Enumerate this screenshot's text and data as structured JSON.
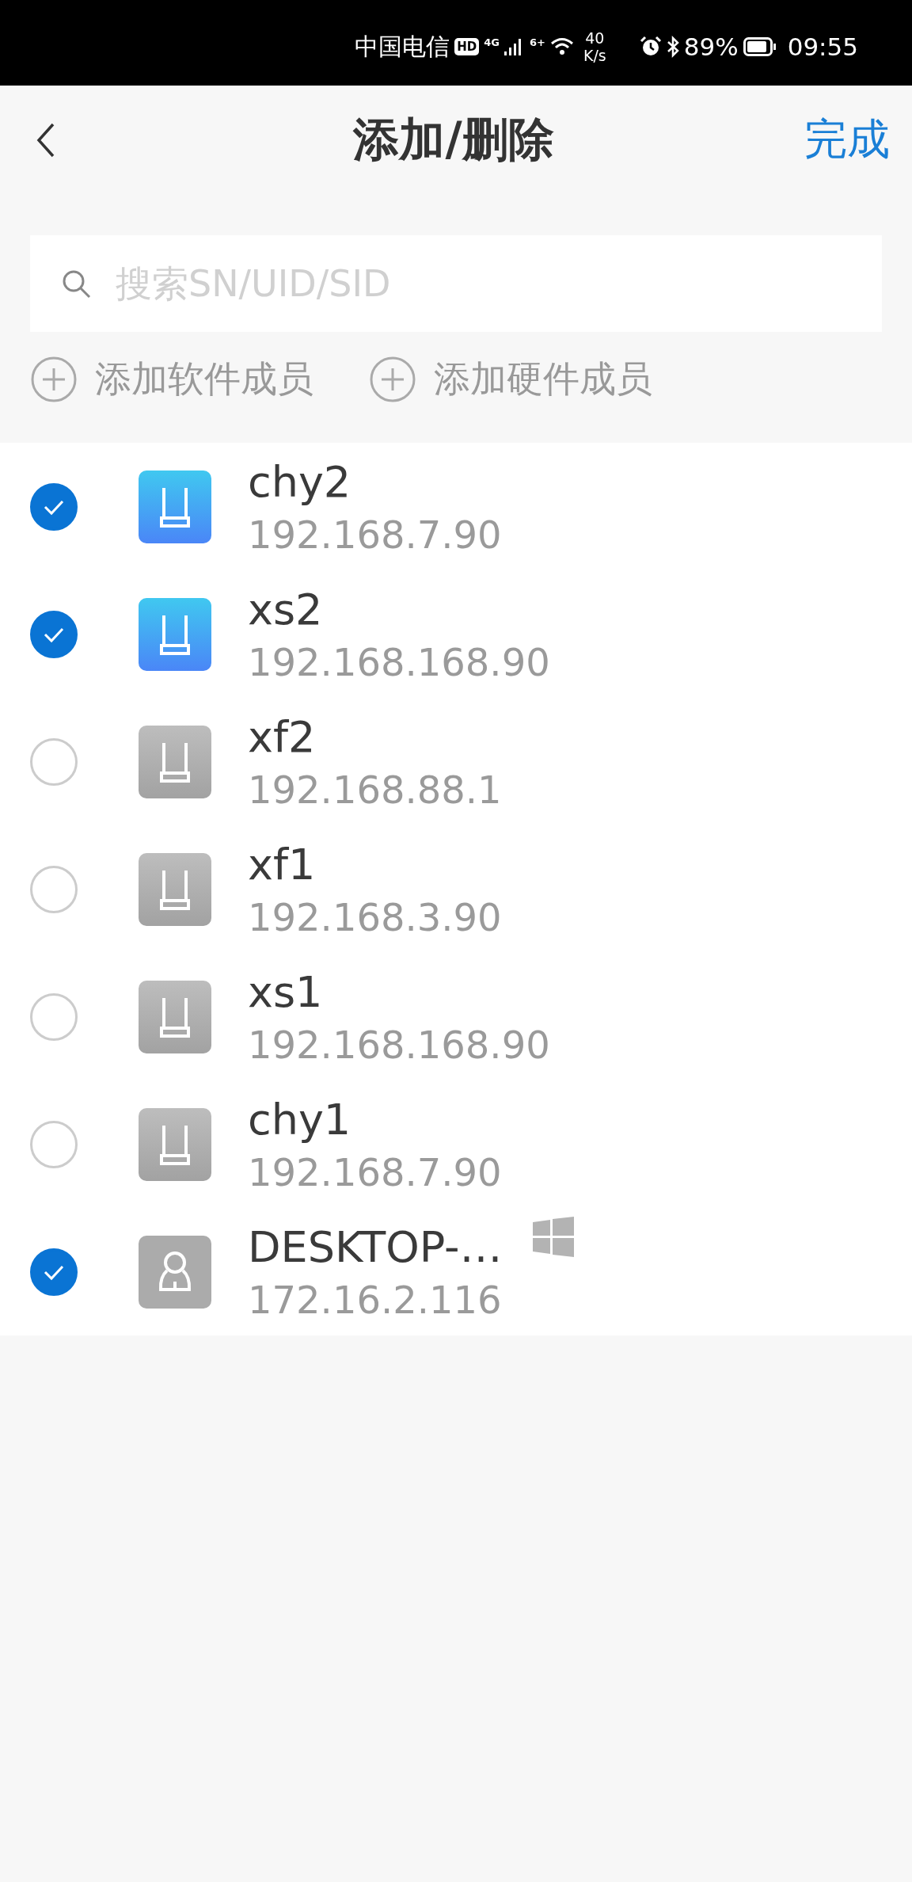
{
  "status_bar": {
    "carrier": "中国电信",
    "hd": "HD",
    "network": "4G",
    "wifi": "6+",
    "speed": "40",
    "speed_unit": "K/s",
    "battery": "89%",
    "time": "09:55"
  },
  "header": {
    "title": "添加/删除",
    "done": "完成"
  },
  "search": {
    "placeholder": "搜索SN/UID/SID"
  },
  "actions": [
    {
      "label": "添加软件成员"
    },
    {
      "label": "添加硬件成员"
    }
  ],
  "devices": [
    {
      "kind": "router",
      "name": "chy2",
      "address": "192.168.7.90",
      "checked": true,
      "online": true
    },
    {
      "kind": "router",
      "name": "xs2",
      "address": "192.168.168.90",
      "checked": true,
      "online": true
    },
    {
      "kind": "router",
      "name": "xf2",
      "address": "192.168.88.1",
      "checked": false,
      "online": false
    },
    {
      "kind": "router",
      "name": "xf1",
      "address": "192.168.3.90",
      "checked": false,
      "online": false
    },
    {
      "kind": "router",
      "name": "xs1",
      "address": "192.168.168.90",
      "checked": false,
      "online": false
    },
    {
      "kind": "router",
      "name": "chy1",
      "address": "192.168.7.90",
      "checked": false,
      "online": false
    },
    {
      "kind": "computer",
      "name": "DESKTOP-…",
      "address": "172.16.2.116",
      "checked": true,
      "online": false
    }
  ]
}
